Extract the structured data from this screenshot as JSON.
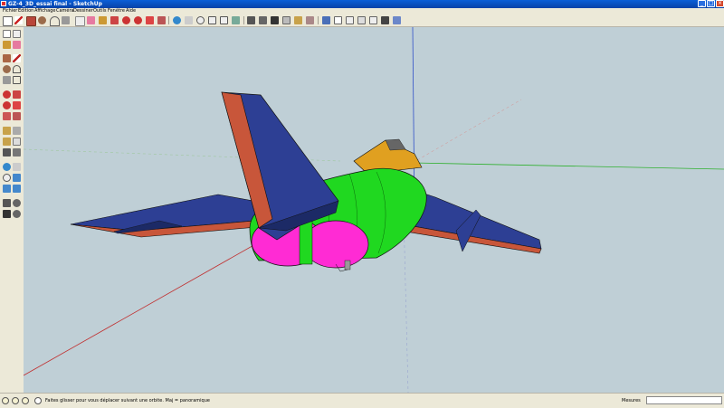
{
  "window": {
    "title": "GZ-4_3D_essai final - SketchUp"
  },
  "menu": {
    "items": [
      "Fichier",
      "Edition",
      "Affichage",
      "Caméra",
      "Dessiner",
      "Outils",
      "Fenêtre",
      "Aide"
    ]
  },
  "toolbar": {
    "tools": [
      "select-tool",
      "line-tool",
      "rectangle-tool",
      "circle-tool",
      "arc-tool",
      "make-component-tool",
      "eraser-tool",
      "paint-bucket-tool",
      "push-pull-tool",
      "move-tool",
      "rotate-tool",
      "follow-me-tool",
      "offset-tool",
      "orbit-tool",
      "pan-tool",
      "zoom-tool",
      "zoom-window-tool",
      "zoom-extents-tool",
      "previous-view-tool",
      "next-view-tool",
      "position-camera-tool",
      "walk-tool",
      "look-around-tool",
      "iso-view",
      "top-view",
      "front-view",
      "right-view",
      "back-view",
      "left-view"
    ]
  },
  "status": {
    "hint": "Faites glisser pour vous déplacer suivant une orbite.  Maj = panoramique",
    "measurements_label": "Mesures",
    "measurements_value": ""
  },
  "colors": {
    "viewport_bg": "#bfcfd6",
    "wing_blue": "#2d3f94",
    "wing_edge_red": "#c8563a",
    "fuselage_green": "#20d820",
    "intake_magenta": "#ff2bd4",
    "canopy_yellow": "#e0a020",
    "axis_red": "#c03030",
    "axis_green": "#30b030",
    "axis_blue": "#3050c8"
  }
}
